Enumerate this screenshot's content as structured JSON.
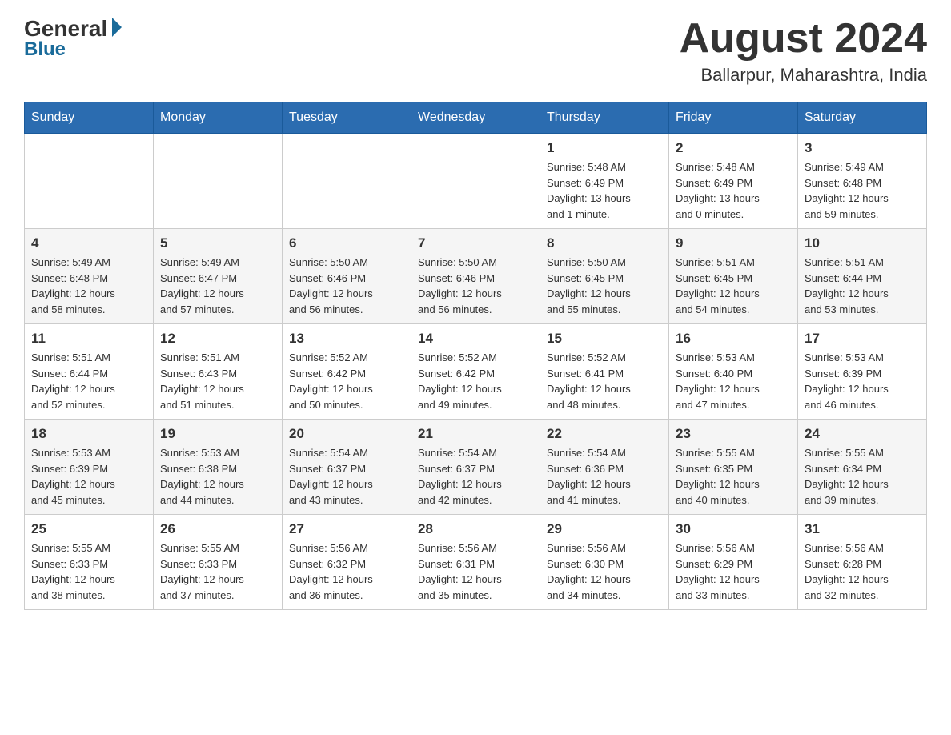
{
  "logo": {
    "general": "General",
    "blue": "Blue"
  },
  "header": {
    "month": "August 2024",
    "location": "Ballarpur, Maharashtra, India"
  },
  "days_of_week": [
    "Sunday",
    "Monday",
    "Tuesday",
    "Wednesday",
    "Thursday",
    "Friday",
    "Saturday"
  ],
  "weeks": [
    [
      {
        "day": "",
        "info": ""
      },
      {
        "day": "",
        "info": ""
      },
      {
        "day": "",
        "info": ""
      },
      {
        "day": "",
        "info": ""
      },
      {
        "day": "1",
        "info": "Sunrise: 5:48 AM\nSunset: 6:49 PM\nDaylight: 13 hours\nand 1 minute."
      },
      {
        "day": "2",
        "info": "Sunrise: 5:48 AM\nSunset: 6:49 PM\nDaylight: 13 hours\nand 0 minutes."
      },
      {
        "day": "3",
        "info": "Sunrise: 5:49 AM\nSunset: 6:48 PM\nDaylight: 12 hours\nand 59 minutes."
      }
    ],
    [
      {
        "day": "4",
        "info": "Sunrise: 5:49 AM\nSunset: 6:48 PM\nDaylight: 12 hours\nand 58 minutes."
      },
      {
        "day": "5",
        "info": "Sunrise: 5:49 AM\nSunset: 6:47 PM\nDaylight: 12 hours\nand 57 minutes."
      },
      {
        "day": "6",
        "info": "Sunrise: 5:50 AM\nSunset: 6:46 PM\nDaylight: 12 hours\nand 56 minutes."
      },
      {
        "day": "7",
        "info": "Sunrise: 5:50 AM\nSunset: 6:46 PM\nDaylight: 12 hours\nand 56 minutes."
      },
      {
        "day": "8",
        "info": "Sunrise: 5:50 AM\nSunset: 6:45 PM\nDaylight: 12 hours\nand 55 minutes."
      },
      {
        "day": "9",
        "info": "Sunrise: 5:51 AM\nSunset: 6:45 PM\nDaylight: 12 hours\nand 54 minutes."
      },
      {
        "day": "10",
        "info": "Sunrise: 5:51 AM\nSunset: 6:44 PM\nDaylight: 12 hours\nand 53 minutes."
      }
    ],
    [
      {
        "day": "11",
        "info": "Sunrise: 5:51 AM\nSunset: 6:44 PM\nDaylight: 12 hours\nand 52 minutes."
      },
      {
        "day": "12",
        "info": "Sunrise: 5:51 AM\nSunset: 6:43 PM\nDaylight: 12 hours\nand 51 minutes."
      },
      {
        "day": "13",
        "info": "Sunrise: 5:52 AM\nSunset: 6:42 PM\nDaylight: 12 hours\nand 50 minutes."
      },
      {
        "day": "14",
        "info": "Sunrise: 5:52 AM\nSunset: 6:42 PM\nDaylight: 12 hours\nand 49 minutes."
      },
      {
        "day": "15",
        "info": "Sunrise: 5:52 AM\nSunset: 6:41 PM\nDaylight: 12 hours\nand 48 minutes."
      },
      {
        "day": "16",
        "info": "Sunrise: 5:53 AM\nSunset: 6:40 PM\nDaylight: 12 hours\nand 47 minutes."
      },
      {
        "day": "17",
        "info": "Sunrise: 5:53 AM\nSunset: 6:39 PM\nDaylight: 12 hours\nand 46 minutes."
      }
    ],
    [
      {
        "day": "18",
        "info": "Sunrise: 5:53 AM\nSunset: 6:39 PM\nDaylight: 12 hours\nand 45 minutes."
      },
      {
        "day": "19",
        "info": "Sunrise: 5:53 AM\nSunset: 6:38 PM\nDaylight: 12 hours\nand 44 minutes."
      },
      {
        "day": "20",
        "info": "Sunrise: 5:54 AM\nSunset: 6:37 PM\nDaylight: 12 hours\nand 43 minutes."
      },
      {
        "day": "21",
        "info": "Sunrise: 5:54 AM\nSunset: 6:37 PM\nDaylight: 12 hours\nand 42 minutes."
      },
      {
        "day": "22",
        "info": "Sunrise: 5:54 AM\nSunset: 6:36 PM\nDaylight: 12 hours\nand 41 minutes."
      },
      {
        "day": "23",
        "info": "Sunrise: 5:55 AM\nSunset: 6:35 PM\nDaylight: 12 hours\nand 40 minutes."
      },
      {
        "day": "24",
        "info": "Sunrise: 5:55 AM\nSunset: 6:34 PM\nDaylight: 12 hours\nand 39 minutes."
      }
    ],
    [
      {
        "day": "25",
        "info": "Sunrise: 5:55 AM\nSunset: 6:33 PM\nDaylight: 12 hours\nand 38 minutes."
      },
      {
        "day": "26",
        "info": "Sunrise: 5:55 AM\nSunset: 6:33 PM\nDaylight: 12 hours\nand 37 minutes."
      },
      {
        "day": "27",
        "info": "Sunrise: 5:56 AM\nSunset: 6:32 PM\nDaylight: 12 hours\nand 36 minutes."
      },
      {
        "day": "28",
        "info": "Sunrise: 5:56 AM\nSunset: 6:31 PM\nDaylight: 12 hours\nand 35 minutes."
      },
      {
        "day": "29",
        "info": "Sunrise: 5:56 AM\nSunset: 6:30 PM\nDaylight: 12 hours\nand 34 minutes."
      },
      {
        "day": "30",
        "info": "Sunrise: 5:56 AM\nSunset: 6:29 PM\nDaylight: 12 hours\nand 33 minutes."
      },
      {
        "day": "31",
        "info": "Sunrise: 5:56 AM\nSunset: 6:28 PM\nDaylight: 12 hours\nand 32 minutes."
      }
    ]
  ]
}
